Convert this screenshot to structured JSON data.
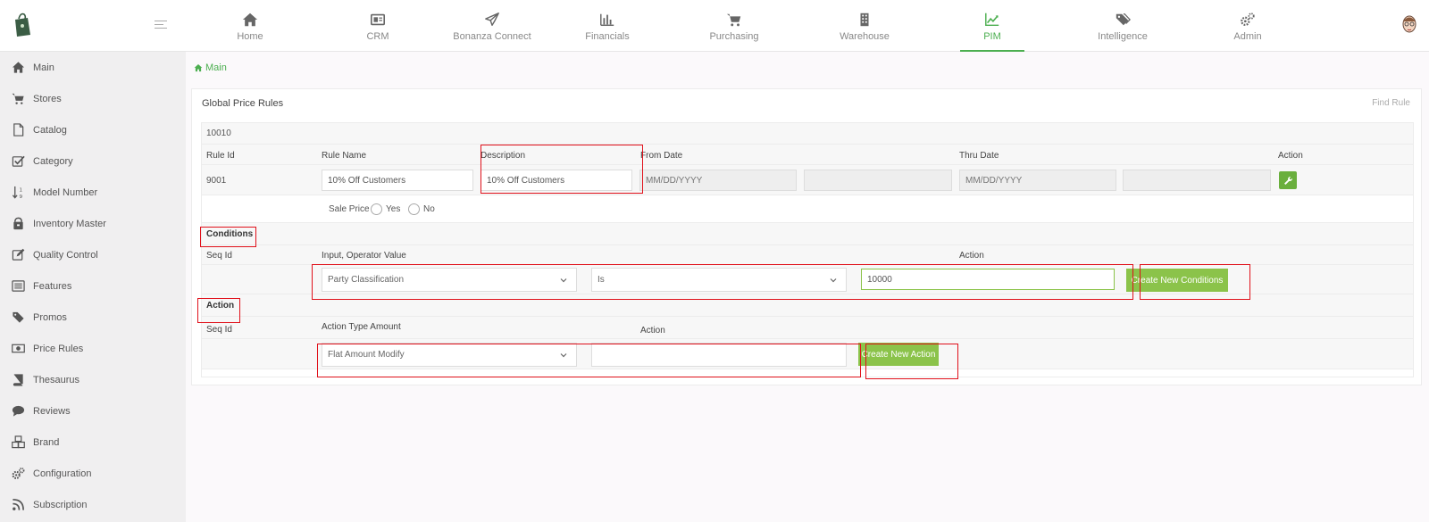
{
  "topnav": {
    "items": [
      {
        "label": "Home",
        "icon": "home-icon"
      },
      {
        "label": "CRM",
        "icon": "crm-icon"
      },
      {
        "label": "Bonanza Connect",
        "icon": "paper-plane-icon"
      },
      {
        "label": "Financials",
        "icon": "bar-chart-icon"
      },
      {
        "label": "Purchasing",
        "icon": "cart-icon"
      },
      {
        "label": "Warehouse",
        "icon": "building-icon"
      },
      {
        "label": "PIM",
        "icon": "line-chart-icon"
      },
      {
        "label": "Intelligence",
        "icon": "tags-icon"
      },
      {
        "label": "Admin",
        "icon": "gears-icon"
      }
    ],
    "active": "PIM",
    "accent_color": "#4caf50"
  },
  "sidebar": {
    "items": [
      {
        "label": "Main",
        "icon": "home-icon"
      },
      {
        "label": "Stores",
        "icon": "cart-icon"
      },
      {
        "label": "Catalog",
        "icon": "file-icon"
      },
      {
        "label": "Category",
        "icon": "checkbox-icon"
      },
      {
        "label": "Model Number",
        "icon": "sort-numeric-icon"
      },
      {
        "label": "Inventory Master",
        "icon": "inventory-icon"
      },
      {
        "label": "Quality Control",
        "icon": "edit-icon"
      },
      {
        "label": "Features",
        "icon": "list-icon"
      },
      {
        "label": "Promos",
        "icon": "tag-icon"
      },
      {
        "label": "Price Rules",
        "icon": "money-icon"
      },
      {
        "label": "Thesaurus",
        "icon": "book-icon"
      },
      {
        "label": "Reviews",
        "icon": "comment-icon"
      },
      {
        "label": "Brand",
        "icon": "cubes-icon"
      },
      {
        "label": "Configuration",
        "icon": "gears-icon"
      },
      {
        "label": "Subscription",
        "icon": "rss-icon"
      }
    ]
  },
  "breadcrumb": {
    "label": "Main"
  },
  "panel": {
    "title": "Global Price Rules",
    "find_rule": "Find Rule",
    "group_id": "10010",
    "rule_headers": {
      "rule_id": "Rule Id",
      "rule_name": "Rule Name",
      "description": "Description",
      "from_date": "From Date",
      "thru_date": "Thru Date",
      "action": "Action"
    },
    "rule": {
      "rule_id": "9001",
      "rule_name": "10% Off Customers",
      "description": "10% Off Customers",
      "from_date_placeholder": "MM/DD/YYYY",
      "thru_date_placeholder": "MM/DD/YYYY"
    },
    "sale_price": {
      "label": "Sale Price",
      "yes": "Yes",
      "no": "No"
    },
    "conditions": {
      "title": "Conditions",
      "seq_header": "Seq Id",
      "input_header": "Input, Operator Value",
      "action_header": "Action",
      "input_select": "Party Classification",
      "operator_select": "Is",
      "value": "10000",
      "create_button": "Create New Conditions"
    },
    "action": {
      "title": "Action",
      "seq_header": "Seq Id",
      "type_header": "Action Type Amount",
      "action_header": "Action",
      "type_select": "Flat Amount Modify",
      "amount": "",
      "create_button": "Create New Action"
    }
  },
  "colors": {
    "green_button": "#8bc34a",
    "highlight": "#e0101a"
  }
}
